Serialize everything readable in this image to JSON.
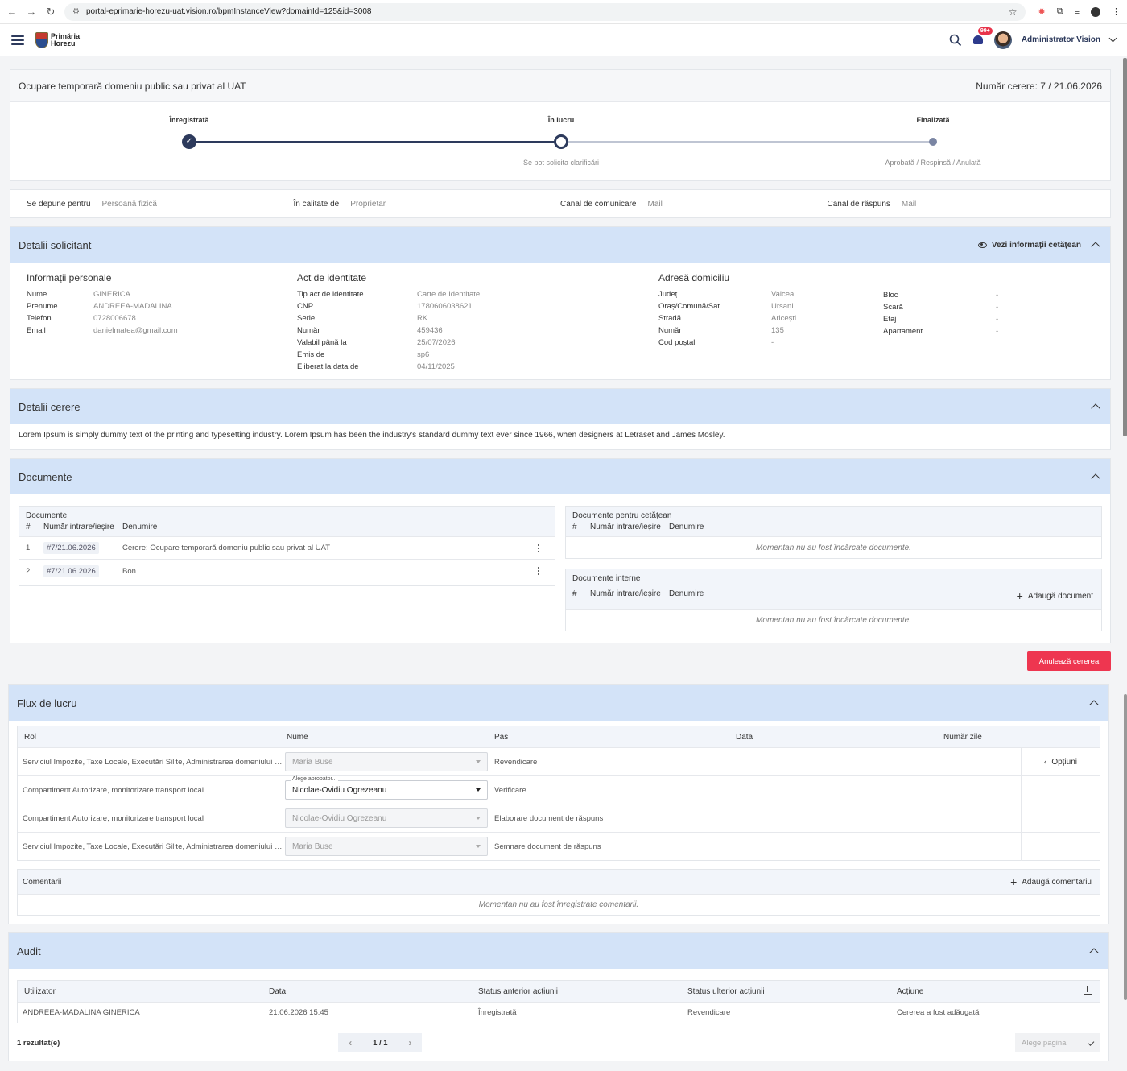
{
  "browser": {
    "url": "portal-eprimarie-horezu-uat.vision.ro/bpmInstanceView?domainId=125&id=3008"
  },
  "header": {
    "logo_line1": "Primăria",
    "logo_line2": "Horezu",
    "badge": "99+",
    "user_name": "Administrator Vision"
  },
  "request": {
    "title": "Ocupare temporară domeniu public sau privat al UAT",
    "number": "Număr cerere: 7 / 21.06.2026"
  },
  "steps": [
    {
      "label": "Înregistrată",
      "sub": "",
      "state": "done"
    },
    {
      "label": "În lucru",
      "sub": "Se pot solicita clarificări",
      "state": "current"
    },
    {
      "label": "Finalizată",
      "sub": "Aprobată / Respinsă / Anulată",
      "state": "future"
    }
  ],
  "info": [
    {
      "k": "Se depune pentru",
      "v": "Persoană fizică"
    },
    {
      "k": "În calitate de",
      "v": "Proprietar"
    },
    {
      "k": "Canal de comunicare",
      "v": "Mail"
    },
    {
      "k": "Canal de răspuns",
      "v": "Mail"
    }
  ],
  "solicitant": {
    "title": "Detalii solicitant",
    "view_link": "Vezi informații cetățean",
    "personal_title": "Informații personale",
    "personal": [
      {
        "k": "Nume",
        "v": "GINERICA"
      },
      {
        "k": "Prenume",
        "v": "ANDREEA-MADALINA"
      },
      {
        "k": "Telefon",
        "v": "0728006678"
      },
      {
        "k": "Email",
        "v": "danielmatea@gmail.com"
      }
    ],
    "id_title": "Act de identitate",
    "id": [
      {
        "k": "Tip act de identitate",
        "v": "Carte de Identitate"
      },
      {
        "k": "CNP",
        "v": "1780606038621"
      },
      {
        "k": "Serie",
        "v": "RK"
      },
      {
        "k": "Număr",
        "v": "459436"
      },
      {
        "k": "Valabil până la",
        "v": "25/07/2026"
      },
      {
        "k": "Emis de",
        "v": "sp6"
      },
      {
        "k": "Eliberat la data de",
        "v": "04/11/2025"
      }
    ],
    "address_title": "Adresă domiciliu",
    "address1": [
      {
        "k": "Județ",
        "v": "Valcea"
      },
      {
        "k": "Oraș/Comună/Sat",
        "v": "Ursani"
      },
      {
        "k": "Stradă",
        "v": "Aricești"
      },
      {
        "k": "Număr",
        "v": "135"
      },
      {
        "k": "Cod poștal",
        "v": "-"
      }
    ],
    "address2": [
      {
        "k": "Bloc",
        "v": "-"
      },
      {
        "k": "Scară",
        "v": "-"
      },
      {
        "k": "Etaj",
        "v": "-"
      },
      {
        "k": "Apartament",
        "v": "-"
      }
    ]
  },
  "details": {
    "title": "Detalii cerere",
    "text": "Lorem Ipsum is simply dummy text of the printing and typesetting industry. Lorem Ipsum has been the industry's standard dummy text ever since 1966, when designers at Letraset and James Mosley."
  },
  "documents": {
    "title": "Documente",
    "main": {
      "title": "Documente",
      "cols": [
        "#",
        "Număr intrare/ieșire",
        "Denumire"
      ],
      "rows": [
        {
          "n": "1",
          "num": "#7/21.06.2026",
          "name": "Cerere: Ocupare temporară domeniu public sau privat al UAT"
        },
        {
          "n": "2",
          "num": "#7/21.06.2026",
          "name": "Bon"
        }
      ]
    },
    "citizen": {
      "title": "Documente pentru cetățean",
      "cols": [
        "#",
        "Număr intrare/ieșire",
        "Denumire"
      ],
      "empty": "Momentan nu au fost încărcate documente."
    },
    "internal": {
      "title": "Documente interne",
      "cols": [
        "#",
        "Număr intrare/ieșire",
        "Denumire"
      ],
      "add": "Adaugă document",
      "empty": "Momentan nu au fost încărcate documente."
    }
  },
  "cancel_button": "Anulează cererea",
  "workflow": {
    "title": "Flux de lucru",
    "cols": [
      "Rol",
      "Nume",
      "Pas",
      "Data",
      "Număr zile"
    ],
    "options": "Opțiuni",
    "rows": [
      {
        "rol": "Serviciul Impozite, Taxe Locale, Executări Silite, Administrarea domeniului p...",
        "nume": "Maria Buse",
        "pas": "Revendicare",
        "label": ""
      },
      {
        "rol": "Compartiment Autorizare, monitorizare transport local",
        "nume": "Nicolae-Ovidiu Ogrezeanu",
        "pas": "Verificare",
        "label": "Alege aprobator..."
      },
      {
        "rol": "Compartiment Autorizare, monitorizare transport local",
        "nume": "Nicolae-Ovidiu Ogrezeanu",
        "pas": "Elaborare document de răspuns",
        "label": ""
      },
      {
        "rol": "Serviciul Impozite, Taxe Locale, Executări Silite, Administrarea domeniului p...",
        "nume": "Maria Buse",
        "pas": "Semnare document de răspuns",
        "label": ""
      }
    ],
    "comments_title": "Comentarii",
    "add_comment": "Adaugă comentariu",
    "comments_empty": "Momentan nu au fost înregistrate comentarii."
  },
  "audit": {
    "title": "Audit",
    "cols": [
      "Utilizator",
      "Data",
      "Status anterior acțiunii",
      "Status ulterior acțiunii",
      "Acțiune"
    ],
    "rows": [
      {
        "user": "ANDREEA-MADALINA GINERICA",
        "date": "21.06.2026 15:45",
        "before": "Înregistrată",
        "after": "Revendicare",
        "action": "Cererea a fost adăugată"
      }
    ],
    "results": "1 rezultat(e)",
    "page": "1 / 1",
    "page_select": "Alege pagina"
  }
}
